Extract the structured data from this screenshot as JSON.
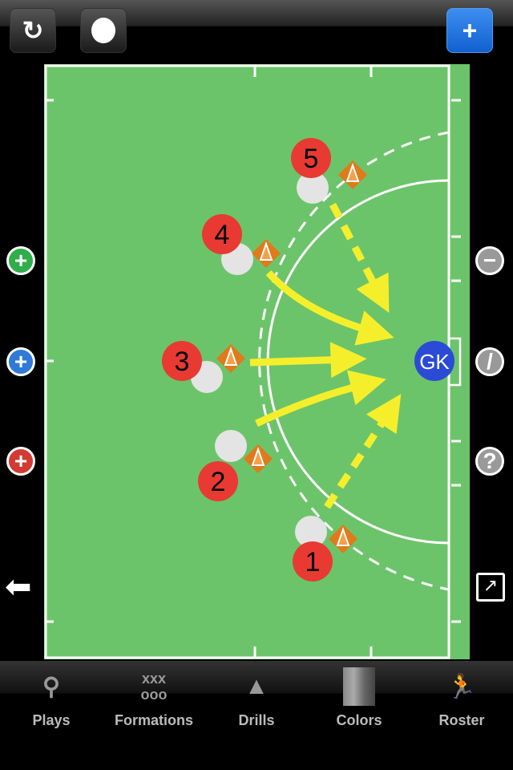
{
  "toolbar": {
    "refresh_icon": "refresh-icon",
    "record_icon": "circle-icon",
    "add_icon": "plus-icon",
    "add_color": "#1a6fe0"
  },
  "field": {
    "grass_color": "#6cc46a",
    "goalkeeper_label": "GK",
    "arrow_color": "#f5ef2b",
    "player_color": "#e83a33",
    "goalkeeper_color": "#2b4bd6",
    "players": [
      {
        "label": "5"
      },
      {
        "label": "4"
      },
      {
        "label": "3"
      },
      {
        "label": "2"
      },
      {
        "label": "1"
      }
    ]
  },
  "left_controls": [
    {
      "icon": "plus-green",
      "color": "#2fae4a"
    },
    {
      "icon": "plus-blue",
      "color": "#2f7ad6"
    },
    {
      "icon": "plus-red",
      "color": "#d23a33"
    }
  ],
  "right_controls": [
    {
      "icon": "minus-icon"
    },
    {
      "icon": "slash-icon"
    },
    {
      "icon": "help-icon",
      "label": "?"
    }
  ],
  "tabs": [
    {
      "label": "Plays",
      "icon": "plays-icon"
    },
    {
      "label": "Formations",
      "icon": "formations-icon"
    },
    {
      "label": "Drills",
      "icon": "cone-icon"
    },
    {
      "label": "Colors",
      "icon": "colors-icon"
    },
    {
      "label": "Roster",
      "icon": "player-icon"
    }
  ]
}
